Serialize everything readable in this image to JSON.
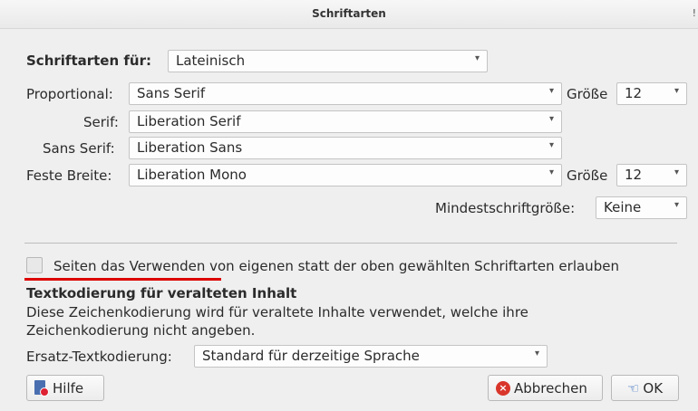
{
  "window": {
    "title": "Schriftarten",
    "close_stub": "!"
  },
  "fonts_for": {
    "label": "Schriftarten für:",
    "value": "Lateinisch"
  },
  "proportional": {
    "label": "Proportional:",
    "value": "Sans Serif"
  },
  "serif": {
    "label": "Serif:",
    "value": "Liberation Serif"
  },
  "sans_serif": {
    "label": "Sans Serif:",
    "value": "Liberation Sans"
  },
  "monospace": {
    "label": "Feste Breite:",
    "value": "Liberation Mono"
  },
  "size_label": "Größe",
  "proportional_size": "12",
  "monospace_size": "12",
  "min_size": {
    "label": "Mindestschriftgröße:",
    "value": "Keine"
  },
  "allow_pages_fonts": {
    "checked": false,
    "label": "Seiten das Verwenden von eigenen statt der oben gewählten Schriftarten erlauben"
  },
  "encoding": {
    "heading": "Textkodierung für veralteten Inhalt",
    "description_line1": "Diese Zeichenkodierung wird für veraltete Inhalte verwendet, welche ihre",
    "description_line2": "Zeichenkodierung nicht angeben.",
    "fallback_label": "Ersatz-Textkodierung:",
    "fallback_value": "Standard für derzeitige Sprache"
  },
  "buttons": {
    "help": "Hilfe",
    "cancel": "Abbrechen",
    "ok": "OK"
  },
  "colors": {
    "annotation_underline": "#dd0000"
  }
}
